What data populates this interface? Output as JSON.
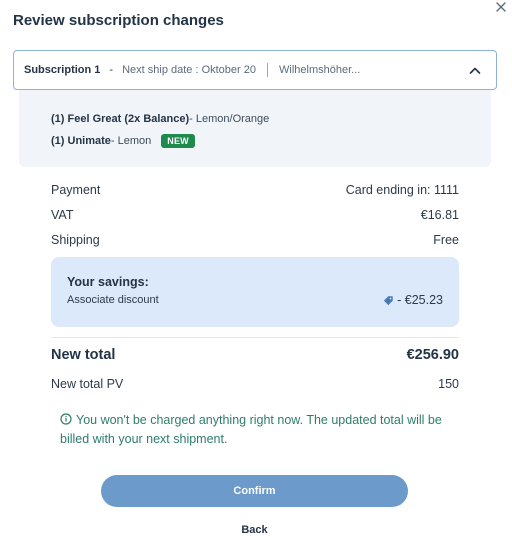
{
  "dialog": {
    "title": "Review subscription changes"
  },
  "subscription": {
    "name": "Subscription 1",
    "dash": "-",
    "ship_label": "Next ship date : Oktober 20",
    "address": "Wilhelmshöher..."
  },
  "items": [
    {
      "qty_name": "(1) Feel Great (2x Balance)",
      "flavor": " - Lemon/Orange",
      "badge": ""
    },
    {
      "qty_name": "(1) Unimate",
      "flavor": " - Lemon",
      "badge": "NEW"
    }
  ],
  "summary": {
    "payment_label": "Payment",
    "payment_value": "Card ending in:  1111",
    "vat_label": "VAT",
    "vat_value": "€16.81",
    "shipping_label": "Shipping",
    "shipping_value": "Free"
  },
  "savings": {
    "title": "Your savings:",
    "label": "Associate discount",
    "amount": "- €25.23"
  },
  "totals": {
    "new_total_label": "New total",
    "new_total_value": "€256.90",
    "pv_label": "New total PV",
    "pv_value": "150"
  },
  "note": "You won't be charged anything right now. The updated total will be billed with your next shipment.",
  "buttons": {
    "confirm": "Confirm",
    "back": "Back"
  },
  "colors": {
    "confirm_bg": "#6b9acb",
    "badge_new": "#1e8a4c",
    "savings_bg": "#dce9fb",
    "note_text": "#2e7d6c"
  },
  "icons": [
    "close-icon",
    "chevron-up-icon",
    "tag-icon",
    "info-icon"
  ]
}
